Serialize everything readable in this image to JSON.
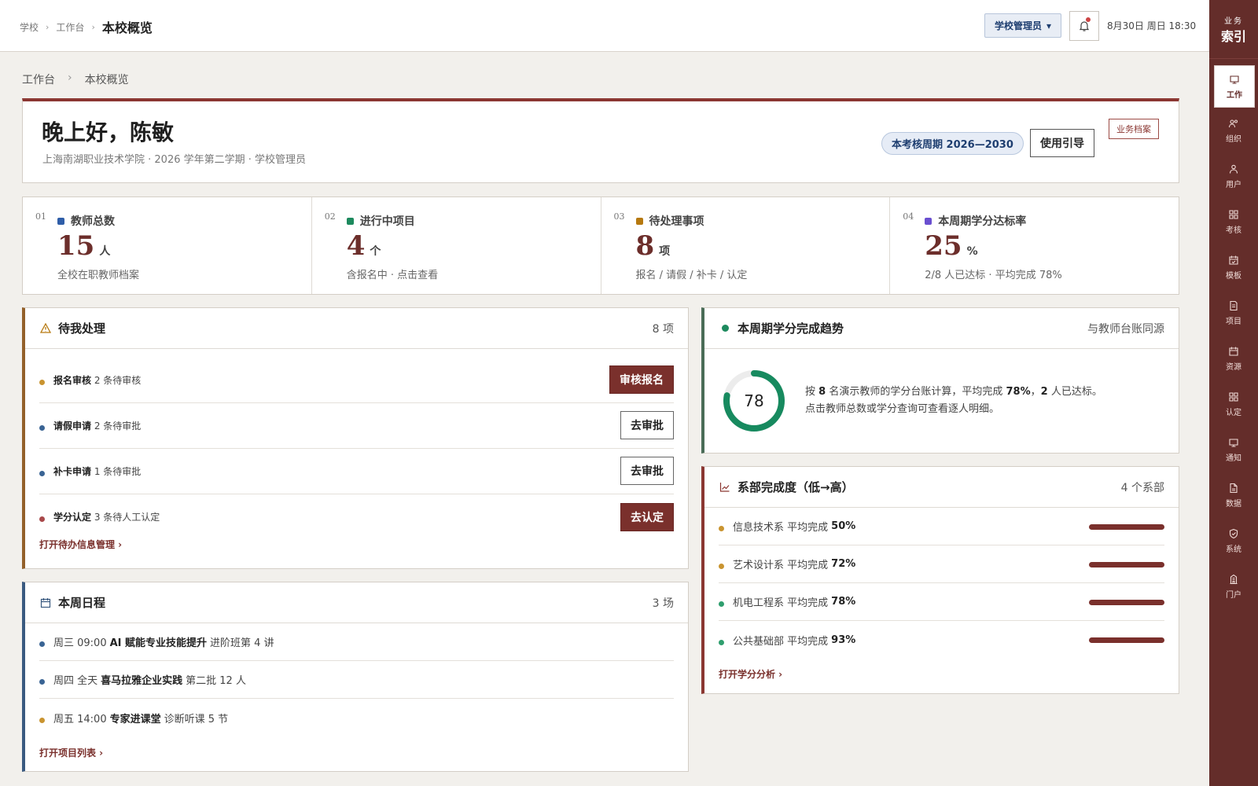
{
  "topbar": {
    "crumbs": [
      "学校",
      "工作台",
      "本校概览"
    ],
    "role_label": "学校管理员",
    "datetime": "8月30日 周日 18:30"
  },
  "rail": {
    "head_small": "业务",
    "head_big": "索引",
    "items": [
      {
        "label": "工作",
        "icon": "monitor-icon"
      },
      {
        "label": "组织",
        "icon": "people-icon"
      },
      {
        "label": "用户",
        "icon": "user-icon"
      },
      {
        "label": "考核",
        "icon": "grid-icon"
      },
      {
        "label": "模板",
        "icon": "calendar-check-icon"
      },
      {
        "label": "项目",
        "icon": "document-icon"
      },
      {
        "label": "资源",
        "icon": "calendar-icon"
      },
      {
        "label": "认定",
        "icon": "grid-icon"
      },
      {
        "label": "通知",
        "icon": "monitor-icon"
      },
      {
        "label": "数据",
        "icon": "file-icon"
      },
      {
        "label": "系统",
        "icon": "shield-icon"
      },
      {
        "label": "门户",
        "icon": "building-icon"
      }
    ]
  },
  "page_crumbs": [
    "工作台",
    "本校概览"
  ],
  "welcome": {
    "greeting": "晚上好，陈敏",
    "subtitle": "上海南湖职业技术学院 · 2026 学年第二学期 · 学校管理员",
    "period": "本考核周期 2026—2030",
    "guide_label": "使用引导",
    "archive_label": "业务档案"
  },
  "stats": [
    {
      "no": "01",
      "title": "教师总数",
      "value": "15",
      "unit": "人",
      "desc": "全校在职教师档案",
      "color": "#2f5ea8"
    },
    {
      "no": "02",
      "title": "进行中项目",
      "value": "4",
      "unit": "个",
      "desc": "含报名中 · 点击查看",
      "color": "#1d8a5e"
    },
    {
      "no": "03",
      "title": "待处理事项",
      "value": "8",
      "unit": "项",
      "desc": "报名 / 请假 / 补卡 / 认定",
      "color": "#b6790f"
    },
    {
      "no": "04",
      "title": "本周期学分达标率",
      "value": "25",
      "unit": "%",
      "desc": "2/8 人已达标 · 平均完成 78%",
      "color": "#6a4fd0"
    }
  ],
  "todo": {
    "title": "待我处理",
    "count": "8 项",
    "items": [
      {
        "name": "报名审核",
        "detail": "2 条待审核",
        "action": "审核报名",
        "style": "fill",
        "color": "#c99430"
      },
      {
        "name": "请假申请",
        "detail": "2 条待审批",
        "action": "去审批",
        "style": "line",
        "color": "#3a6494"
      },
      {
        "name": "补卡申请",
        "detail": "1 条待审批",
        "action": "去审批",
        "style": "line",
        "color": "#3a6494"
      },
      {
        "name": "学分认定",
        "detail": "3 条待人工认定",
        "action": "去认定",
        "style": "fill",
        "color": "#a8484a"
      }
    ],
    "link": "打开待办信息管理 ›"
  },
  "trend": {
    "title": "本周期学分完成趋势",
    "right": "与教师台账同源",
    "ring_value": "78",
    "ring_percent": 78,
    "line1_a": "按",
    "line1_n": "8",
    "line1_b": "名演示教师的学分台账计算，平均完成",
    "line1_p": "78%",
    "line1_c": "，",
    "line1_k": "2",
    "line1_d": "人已达标。",
    "line2": "点击教师总数或学分查询可查看逐人明细。"
  },
  "dept": {
    "title": "系部完成度（低→高）",
    "count": "4 个系部",
    "items": [
      {
        "name": "信息技术系",
        "label": "平均完成",
        "value": "50%",
        "color": "#c99430"
      },
      {
        "name": "艺术设计系",
        "label": "平均完成",
        "value": "72%",
        "color": "#c99430"
      },
      {
        "name": "机电工程系",
        "label": "平均完成",
        "value": "78%",
        "color": "#2f9e6e"
      },
      {
        "name": "公共基础部",
        "label": "平均完成",
        "value": "93%",
        "color": "#2f9e6e"
      }
    ],
    "link": "打开学分分析 ›"
  },
  "schedule": {
    "title": "本周日程",
    "count": "3 场",
    "items": [
      {
        "when": "周三 09:00",
        "name": "AI 赋能专业技能提升",
        "detail": "进阶班第 4 讲",
        "color": "#3a6494"
      },
      {
        "when": "周四 全天",
        "name": "喜马拉雅企业实践",
        "detail": "第二批 12 人",
        "color": "#3a6494"
      },
      {
        "when": "周五 14:00",
        "name": "专家进课堂",
        "detail": "诊断听课 5 节",
        "color": "#c99430"
      }
    ],
    "link": "打开项目列表 ›"
  }
}
